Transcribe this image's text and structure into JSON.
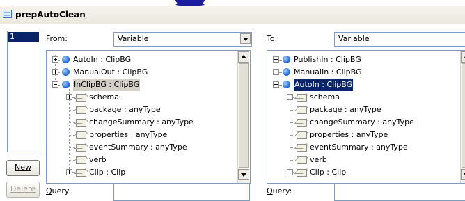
{
  "window": {
    "title": "prepAutoClean"
  },
  "name_list": {
    "items": [
      "1"
    ]
  },
  "buttons": {
    "new_label": "New",
    "delete_label": "Delete"
  },
  "from_panel": {
    "label_pre": "F",
    "label_u": "r",
    "label_post": "om:",
    "dropdown_value": "Variable",
    "tree": [
      {
        "label": "AutoIn : ClipBG"
      },
      {
        "label": "ManualOut : ClipBG"
      },
      {
        "label": "InClipBG : ClipBG"
      },
      {
        "label": "schema"
      },
      {
        "label": "package : anyType"
      },
      {
        "label": "changeSummary : anyType"
      },
      {
        "label": "properties : anyType"
      },
      {
        "label": "eventSummary : anyType"
      },
      {
        "label": "verb"
      },
      {
        "label": "Clip : Clip"
      }
    ],
    "query_label_u": "Q",
    "query_label_post": "uery:",
    "query_value": ""
  },
  "to_panel": {
    "label_pre": "",
    "label_u": "T",
    "label_post": "o:",
    "dropdown_value": "Variable",
    "tree": [
      {
        "label": "PublishIn : ClipBG"
      },
      {
        "label": "ManualIn : ClipBG"
      },
      {
        "label": "AutoIn : ClipBG"
      },
      {
        "label": "schema"
      },
      {
        "label": "package : anyType"
      },
      {
        "label": "changeSummary : anyType"
      },
      {
        "label": "properties : anyType"
      },
      {
        "label": "eventSummary : anyType"
      },
      {
        "label": "verb"
      },
      {
        "label": "Clip : Clip"
      }
    ],
    "query_label_u": "Q",
    "query_label_post": "uery:",
    "query_value": ""
  },
  "colors": {
    "selection": "#0a246a",
    "highlight": "#d4d0c8",
    "border": "#7f9db9",
    "icon_blue": "#2a6fd6"
  }
}
